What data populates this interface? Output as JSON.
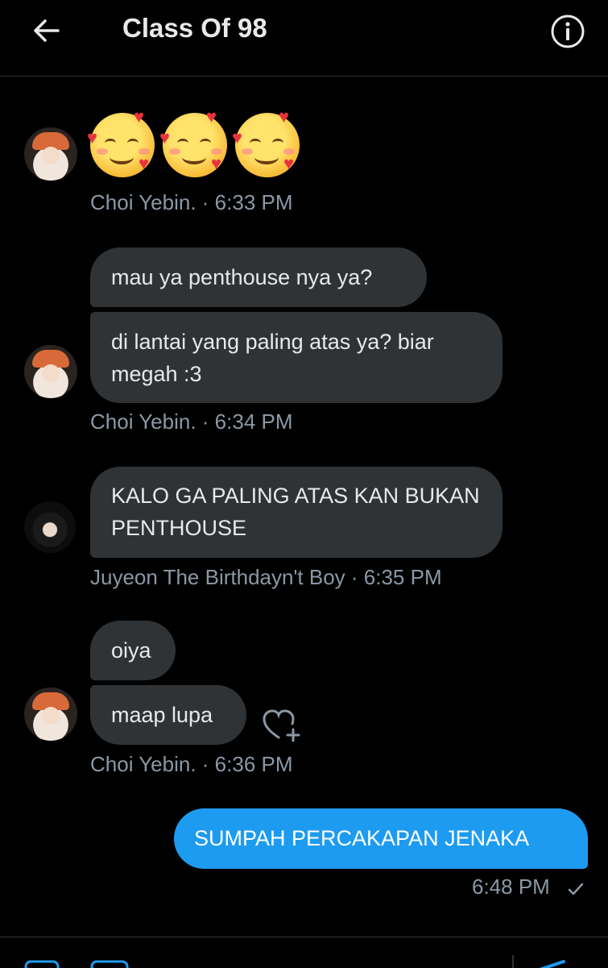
{
  "header": {
    "title": "Class Of 98",
    "back_icon": "arrow-left-icon",
    "info_icon": "info-circle-icon"
  },
  "colors": {
    "background": "#000000",
    "received_bubble": "#2f3336",
    "sent_bubble": "#1d9bf0",
    "meta_text": "#8b98a5",
    "primary_text": "#e7e9ea"
  },
  "groups": [
    {
      "sender": "Choi Yebin.",
      "time": "6:33 PM",
      "emojis": [
        "smiling-face-with-hearts",
        "smiling-face-with-hearts",
        "smiling-face-with-hearts"
      ]
    },
    {
      "sender": "Choi Yebin.",
      "time": "6:34 PM",
      "messages": [
        "mau ya penthouse nya ya?",
        "di lantai yang paling atas ya? biar megah :3"
      ]
    },
    {
      "sender": "Juyeon The Birthdayn't Boy",
      "time": "6:35 PM",
      "messages": [
        "KALO GA PALING ATAS KAN BUKAN PENTHOUSE"
      ]
    },
    {
      "sender": "Choi Yebin.",
      "time": "6:36 PM",
      "messages": [
        "oiya",
        "maap lupa"
      ]
    }
  ],
  "sent": {
    "text": "SUMPAH PERCAKAPAN JENAKA",
    "time": "6:48 PM",
    "status_icon": "check-icon"
  },
  "separator": " · "
}
